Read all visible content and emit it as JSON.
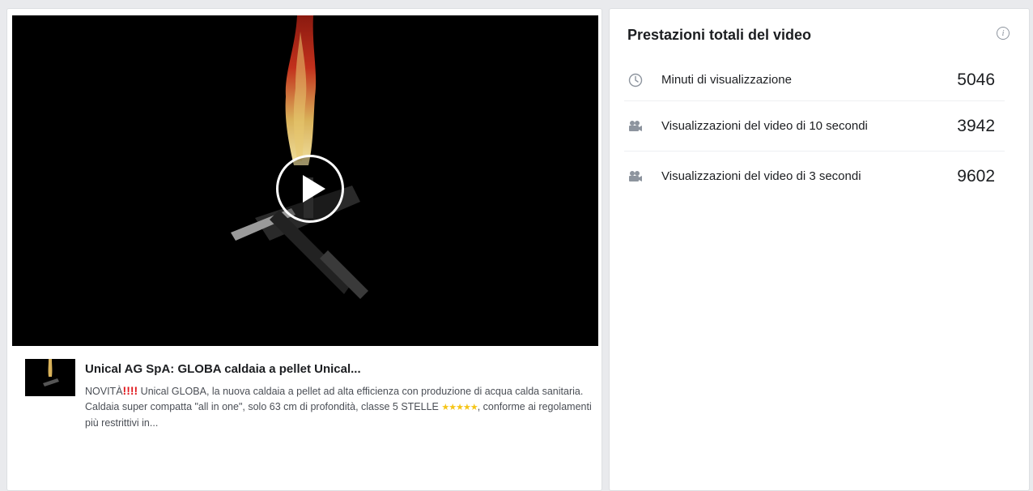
{
  "video": {
    "play_label": "Play video"
  },
  "post": {
    "title": "Unical AG SpA: GLOBA caldaia a pellet Unical...",
    "desc_prefix": "NOVITÀ",
    "desc_bangs": "!!!!",
    "desc_main": " Unical GLOBA, la nuova caldaia a pellet ad alta efficienza con produzione di acqua calda sanitaria. Caldaia super compatta \"all in one\", solo 63 cm di profondità, classe 5 STELLE ",
    "desc_stars": "★★★★★",
    "desc_suffix": ", conforme ai regolamenti più restrittivi in..."
  },
  "stats": {
    "title": "Prestazioni totali del video",
    "info_icon": "i",
    "rows": [
      {
        "icon": "clock-icon",
        "label": "Minuti di visualizzazione",
        "value": "5046"
      },
      {
        "icon": "video-camera-icon",
        "label": "Visualizzazioni del video di 10 secondi",
        "value": "3942"
      },
      {
        "icon": "video-camera-icon",
        "label": "Visualizzazioni del video di 3 secondi",
        "value": "9602"
      }
    ]
  },
  "colors": {
    "page_bg": "#e9eaed",
    "card_bg": "#ffffff",
    "text_primary": "#1c1e21",
    "text_secondary": "#4b4f56",
    "alert_red": "#e0161b",
    "star_yellow": "#f5c518"
  }
}
